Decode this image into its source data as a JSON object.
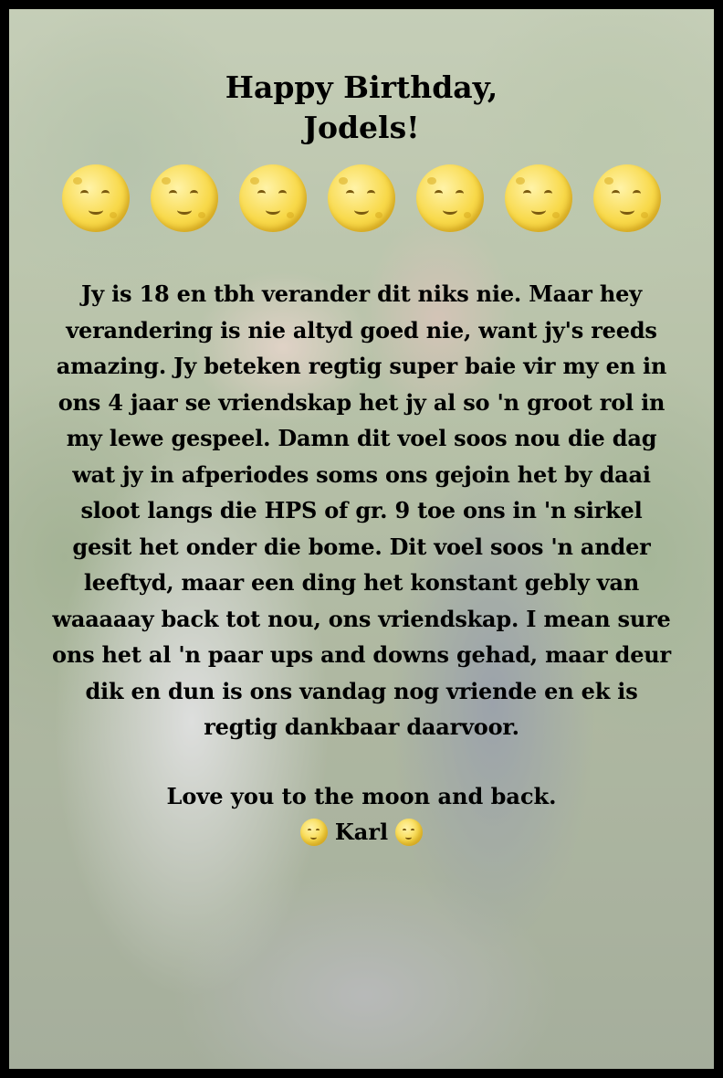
{
  "card": {
    "title_line1": "Happy Birthday,",
    "title_line2": "Jodels!",
    "moon_icon_count": 7,
    "message": "Jy is 18 en tbh verander dit niks nie. Maar hey verandering is nie altyd goed nie, want jy's reeds amazing. Jy beteken regtig super baie vir my en in ons 4 jaar se vriendskap het jy al so 'n groot rol in my lewe gespeel. Damn dit voel soos nou die dag wat jy in afperiodes soms ons gejoin het by daai sloot langs die HPS of gr. 9 toe ons in 'n sirkel gesit het onder die bome. Dit voel soos 'n ander leeftyd, maar een ding het konstant gebly van waaaaay back tot nou, ons vriendskap. I mean sure ons het al 'n paar ups and downs gehad, maar deur dik en dun is ons vandag nog vriende en ek is regtig dankbaar daarvoor.",
    "closing": "Love you to the moon and back.",
    "signature": "Karl"
  },
  "icons": {
    "moon": "full-moon-face-icon"
  },
  "colors": {
    "border": "#000000",
    "text": "#000000",
    "moon": "#f8d94a"
  }
}
